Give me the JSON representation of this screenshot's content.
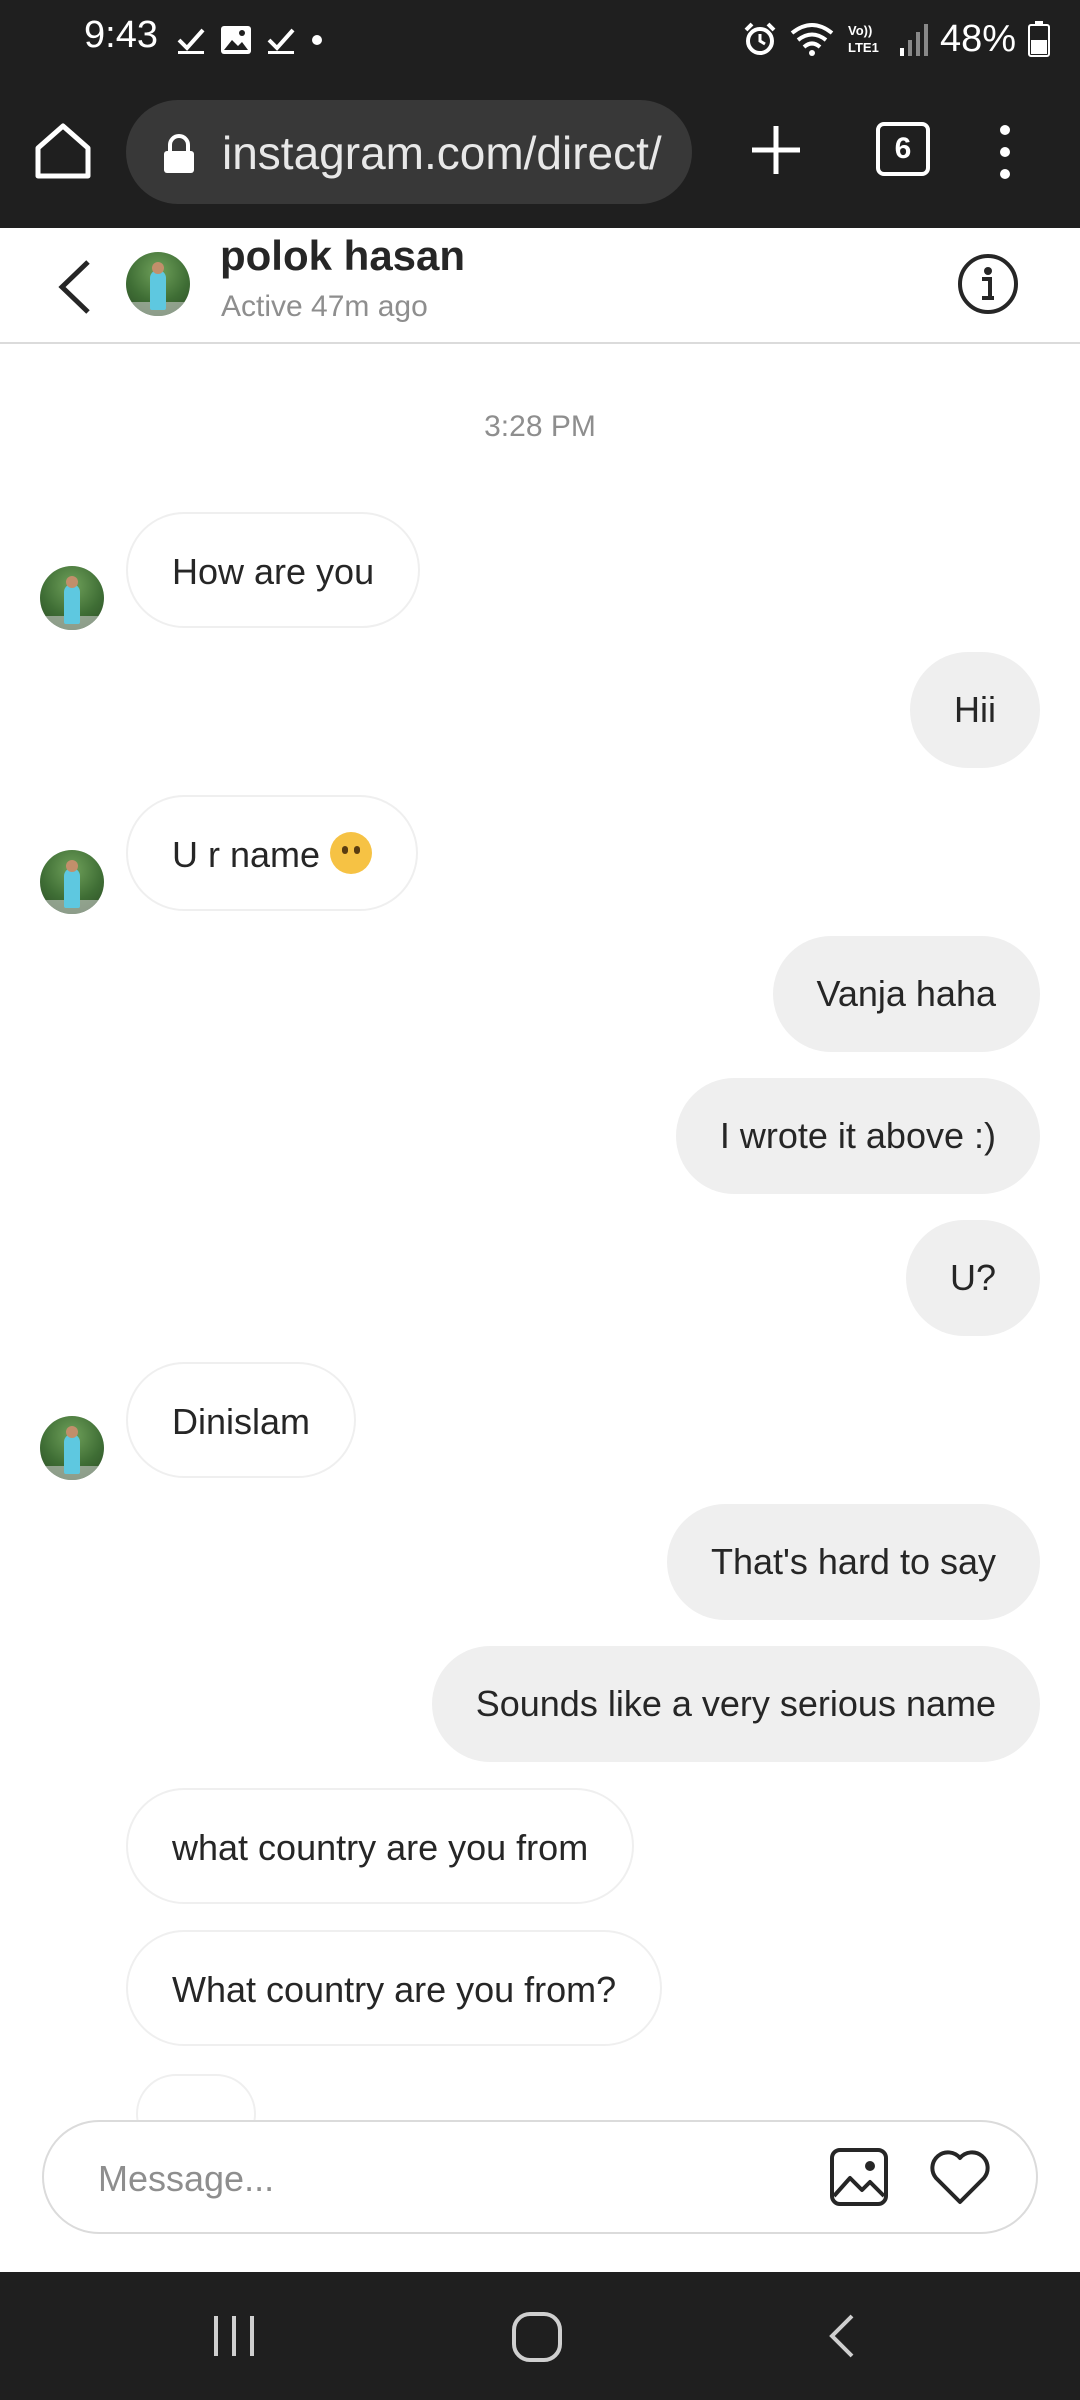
{
  "status_bar": {
    "time": "9:43",
    "battery": "48%",
    "icons_left": [
      "check-icon",
      "image-icon",
      "check-icon",
      "dot-icon"
    ],
    "icons_right": [
      "alarm-icon",
      "wifi-icon",
      "volte-icon",
      "signal-icon",
      "battery-icon"
    ]
  },
  "browser": {
    "url": "instagram.com/direct/",
    "tab_count": "6"
  },
  "chat": {
    "contact_name": "polok hasan",
    "contact_status": "Active 47m ago",
    "timestamp": "3:28 PM",
    "messages": [
      {
        "from": "them",
        "text": "How are you",
        "avatar": true
      },
      {
        "from": "me",
        "text": "Hii"
      },
      {
        "from": "them",
        "text": "U r name",
        "emoji": "thinking-face",
        "avatar": true
      },
      {
        "from": "me",
        "text": "Vanja haha"
      },
      {
        "from": "me",
        "text": "I wrote it above :)"
      },
      {
        "from": "me",
        "text": "U?"
      },
      {
        "from": "them",
        "text": "Dinislam",
        "avatar": true
      },
      {
        "from": "me",
        "text": "That's hard to say"
      },
      {
        "from": "me",
        "text": "Sounds like a very serious name"
      },
      {
        "from": "them",
        "text": "what country are you from"
      },
      {
        "from": "them",
        "text": "What country are you from?"
      }
    ]
  },
  "composer": {
    "placeholder": "Message..."
  },
  "colors": {
    "system_bar": "#1f1f1f",
    "outgoing_bubble": "#efefef",
    "incoming_border": "#efefef",
    "secondary_text": "#8e8e8e"
  }
}
